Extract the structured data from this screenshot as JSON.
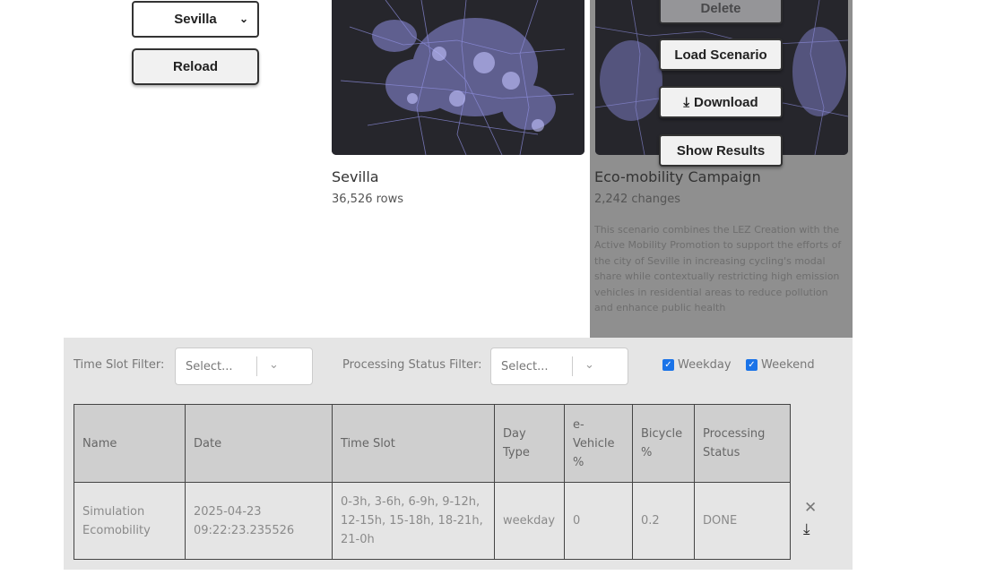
{
  "city_select": {
    "value": "Sevilla"
  },
  "reload_label": "Reload",
  "base_card": {
    "title": "Sevilla",
    "rows": "36,526 rows"
  },
  "scenario_card": {
    "title": "Eco-mobility Campaign",
    "changes": "2,242 changes",
    "description": "This scenario combines the LEZ Creation with the Active Mobility Promotion to support the efforts of the city of Seville in increasing cycling's modal share while contextually restricting high emission vehicles in residential areas to reduce pollution and enhance public health",
    "buttons": {
      "delete": "Delete",
      "load": "Load Scenario",
      "download": "Download",
      "show_results": "Show Results"
    }
  },
  "filters": {
    "time_slot_label": "Time Slot Filter:",
    "time_slot_placeholder": "Select...",
    "status_label": "Processing Status Filter:",
    "status_placeholder": "Select...",
    "weekday_label": "Weekday",
    "weekday_checked": true,
    "weekend_label": "Weekend",
    "weekend_checked": true
  },
  "table": {
    "headers": [
      "Name",
      "Date",
      "Time Slot",
      "Day Type",
      "e-Vehicle %",
      "Bicycle %",
      "Processing Status"
    ],
    "rows": [
      {
        "name": "Simulation Ecomobility",
        "date": "2025-04-23 09:22:23.235526",
        "time_slot": "0-3h, 3-6h, 6-9h, 9-12h, 12-15h, 15-18h, 18-21h, 21-0h",
        "day_type": "weekday",
        "e_vehicle": "0",
        "bicycle": "0.2",
        "status": "DONE"
      }
    ]
  },
  "colors": {
    "accent": "#1a73e8",
    "map_bg": "#26262c",
    "map_roads": "#8f8fe0",
    "selected_card": "#8f8f8f"
  }
}
